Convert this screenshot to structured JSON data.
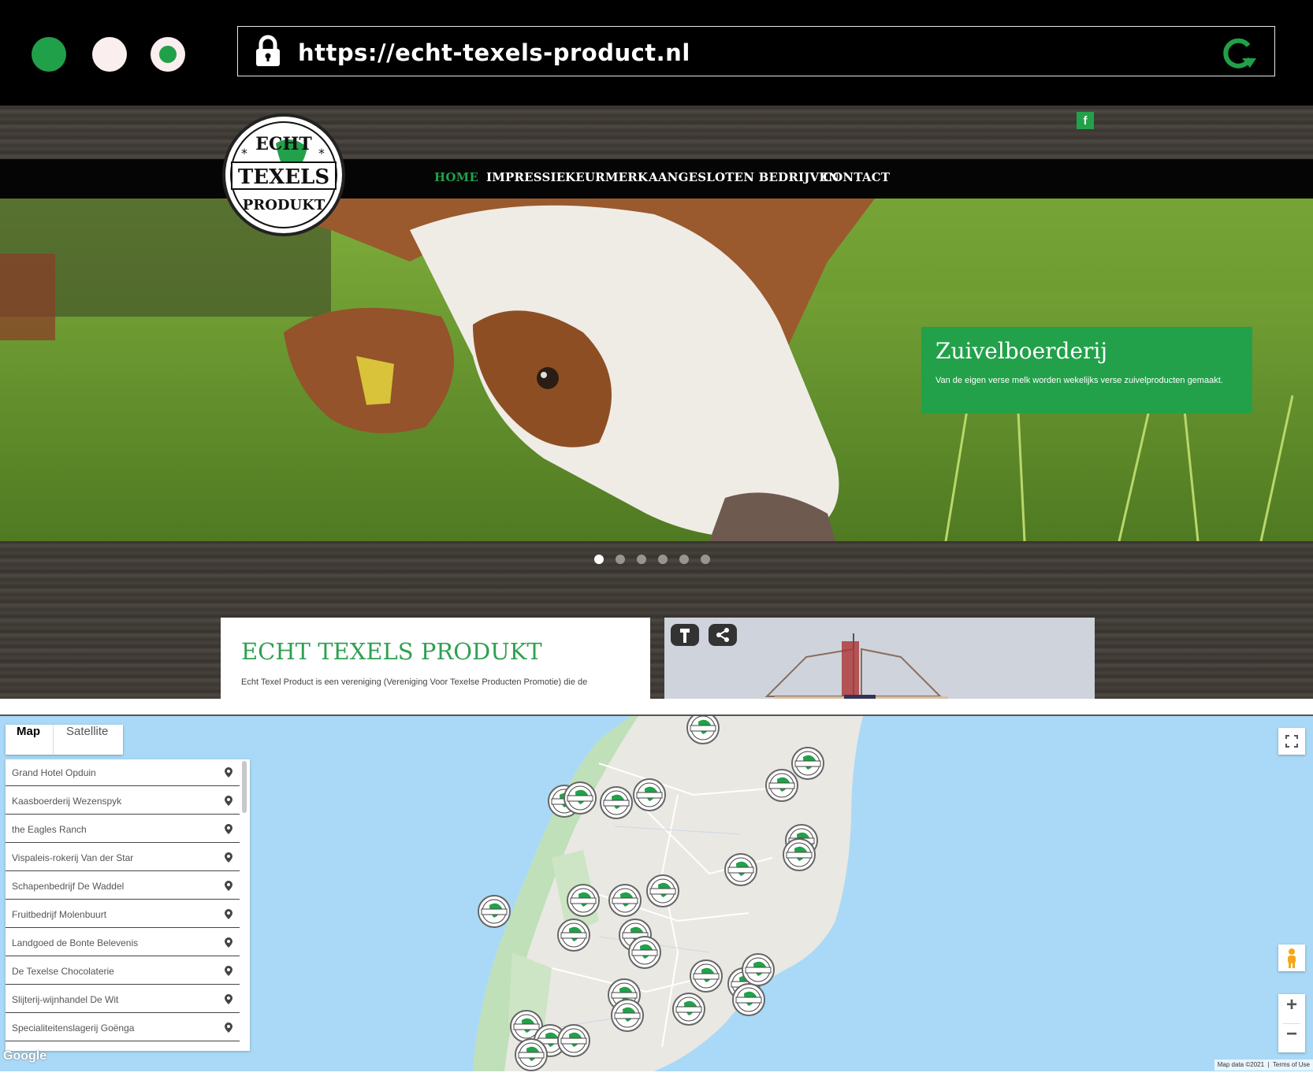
{
  "browser": {
    "url": "https://echt-texels-product.nl"
  },
  "site": {
    "nav": [
      {
        "label": "HOME",
        "active": true
      },
      {
        "label": "IMPRESSIE",
        "active": false
      },
      {
        "label": "KEURMERK",
        "active": false
      },
      {
        "label": "AANGESLOTEN BEDRIJVEN",
        "active": false
      },
      {
        "label": "CONTACT",
        "active": false
      }
    ],
    "social_icon": "facebook-icon",
    "social_label": "f",
    "logo": {
      "text_top": "ECHT",
      "text_middle": "TEXELS",
      "text_bottom": "PRODUKT"
    },
    "slide": {
      "title": "Zuivelboerderij",
      "text": "Van de eigen verse melk worden wekelijks verse zuivelproducten gemaakt.",
      "count": 6,
      "current": 1
    },
    "intro": {
      "title": "ECHT TEXELS PRODUKT",
      "text": "Echt Texel Product is een vereniging (Vereniging Voor Texelse Producten Promotie) die de"
    },
    "accent": "#22a14a"
  },
  "map": {
    "tabs": [
      "Map",
      "Satellite"
    ],
    "selected_tab": "Map",
    "locations": [
      "Grand Hotel Opduin",
      "Kaasboerderij Wezenspyk",
      "the Eagles Ranch",
      "Vispaleis-rokerij Van der Star",
      "Schapenbedrijf De Waddel",
      "Fruitbedrijf Molenbuurt",
      "Landgoed de Bonte Belevenis",
      "De Texelse Chocolaterie",
      "Slijterij-wijnhandel De Wit",
      "Specialiteitenslagerij Goënga"
    ],
    "zoom_in": "+",
    "zoom_out": "−",
    "google_label": "Google",
    "attribution": "Map data ©2021",
    "terms": "Terms of Use"
  }
}
